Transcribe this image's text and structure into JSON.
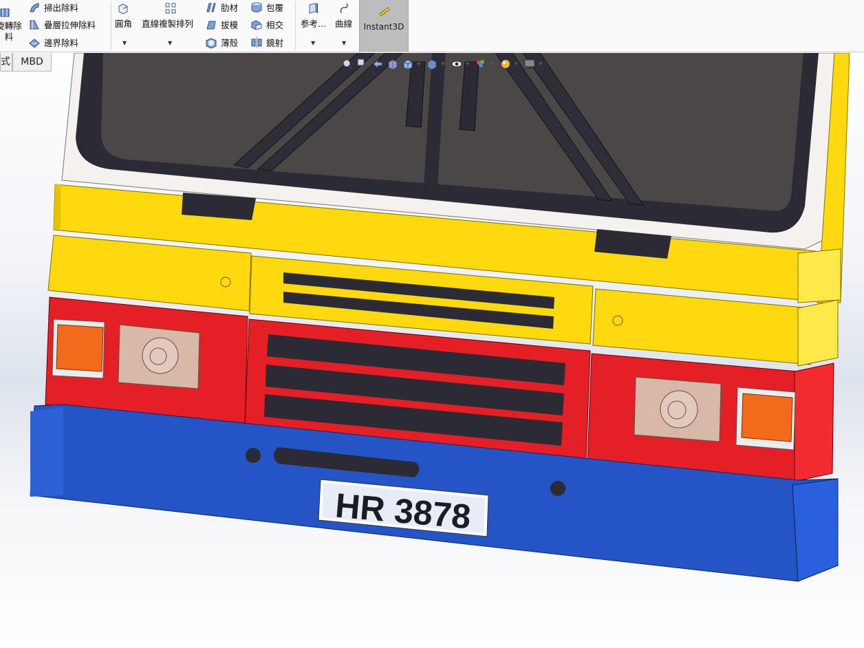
{
  "ribbon": {
    "revolve_cut": [
      "旋轉除",
      "料"
    ],
    "swept_cut": "掃出除料",
    "lofted_cut": "疊層拉伸除料",
    "boundary_cut": "邊界除料",
    "fillet": "圓角",
    "linear_pattern": "直線複製排列",
    "rib": "肋材",
    "draft": "拔模",
    "shell": "薄殼",
    "wrap": "包覆",
    "intersect": "相交",
    "mirror": "鏡射",
    "reference": "参考...",
    "curves": "曲線",
    "instant3d": "Instant3D"
  },
  "tabs": [
    "式",
    "MBD"
  ],
  "model": {
    "license_plate": "HR 3878",
    "colors": {
      "yellow": "#ffd90f",
      "red": "#e42026",
      "blue": "#2554c7",
      "glass": "#4b4747",
      "dark": "#2a2a33",
      "indicator": "#f26a1b",
      "headlamp": "#d9b8a8"
    }
  },
  "icons": {
    "heads_up": [
      "zoom-fit-icon",
      "zoom-area-icon",
      "previous-view-icon",
      "section-view-icon",
      "view-orientation-icon",
      "display-style-icon",
      "hide-show-items-icon",
      "edit-appearance-icon",
      "apply-scene-icon",
      "view-settings-icon"
    ]
  }
}
